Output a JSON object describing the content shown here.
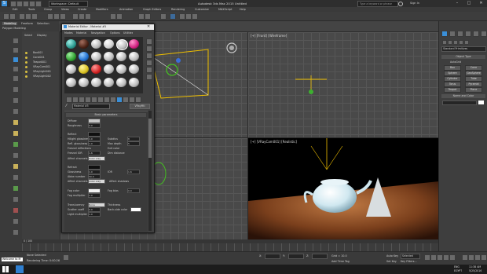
{
  "app": {
    "title": "Autodesk 3ds Max 2015   Untitled",
    "workspace": "Workspace: Default",
    "search_placeholder": "Type a keyword or phrase",
    "signin": "Sign In"
  },
  "menu": [
    "Edit",
    "Tools",
    "Group",
    "Views",
    "Create",
    "Modifiers",
    "Animation",
    "Graph Editors",
    "Rendering",
    "Customize",
    "MAXScript",
    "Help"
  ],
  "ribbon_tabs": [
    "Modeling",
    "Freeform",
    "Selection",
    "Object Paint",
    "Populate"
  ],
  "ribbon_sub": "Polygon Modeling",
  "scene_explorer": {
    "tabs": [
      "Select",
      "Display"
    ],
    "items": [
      "Box001",
      "Cone001",
      "Teapot001",
      "VRayCam001",
      "VRayLight001",
      "VRayLight002"
    ]
  },
  "viewports": {
    "top_right": "[+] [Front] [Wireframe]",
    "bottom_right": "[+] [VRayCam001] [Realistic]",
    "top_left": "",
    "bottom_left": ""
  },
  "command_panel": {
    "dropdown": "Standard Primitives",
    "rollout_object_type": "Object Type",
    "autogrid": "AutoGrid",
    "buttons": [
      "Box",
      "Cone",
      "Sphere",
      "GeoSphere",
      "Cylinder",
      "Tube",
      "Torus",
      "Pyramid",
      "Teapot",
      "Plane"
    ],
    "rollout_name": "Name and Color"
  },
  "material_editor": {
    "title": "Material Editor - Material #5",
    "menu": [
      "Modes",
      "Material",
      "Navigation",
      "Options",
      "Utilities"
    ],
    "material_name": "Material #5",
    "type": "VRayMtl",
    "rollout": "Basic parameters",
    "diffuse": "Diffuse",
    "roughness": "Roughness",
    "roughness_val": "0.0",
    "reflect": "Reflect",
    "hilight_gloss": "Hilight glossiness",
    "refl_gloss": "Refl. glossiness",
    "fresnel": "Fresnel reflections",
    "fresnel_ior": "Fresnel IOR",
    "subdivs": "Subdivs",
    "affect_channels": "Affect channels",
    "color_only": "Color only",
    "max_depth": "Max depth",
    "max_depth_val": "5",
    "exit_color": "Exit color",
    "dim_distance": "Dim distance",
    "refract": "Refract",
    "glossiness": "Glossiness",
    "ior": "IOR",
    "abbe": "Abbe number",
    "affect_shadows": "Affect shadows",
    "fog_color": "Fog color",
    "fog_mult": "Fog multiplier",
    "fog_bias": "Fog bias",
    "translucency": "Translucency",
    "translucency_val": "None",
    "back_side": "Back-side color",
    "thickness": "Thickness",
    "scatter": "Scatter coeff",
    "light_mult": "Light multiplier",
    "one": "1.0",
    "zero": "0.0",
    "eight": "8",
    "ior_val": "1.6",
    "fifty": "50.0"
  },
  "status": {
    "selection": "None Selected",
    "prompt": "Rendering Time: 0:00:26",
    "listener": "Welcome to M",
    "timeline": "0 / 100",
    "add_time_tag": "Add Time Tag",
    "autokey": "Auto Key",
    "selected": "Selected",
    "setkey": "Set Key",
    "key_filters": "Key Filters...",
    "x_label": "X:",
    "y_label": "Y:",
    "z_label": "Z:",
    "grid": "Grid = 10.0"
  },
  "taskbar": {
    "lang": "ENG",
    "time": "11:38 AM",
    "date": "5/25/2016",
    "region": "EGYPT"
  },
  "colors": {
    "accent": "#2f7fd0",
    "viewport_active": "#f0c000",
    "taskbar": "#1c1c1c"
  }
}
